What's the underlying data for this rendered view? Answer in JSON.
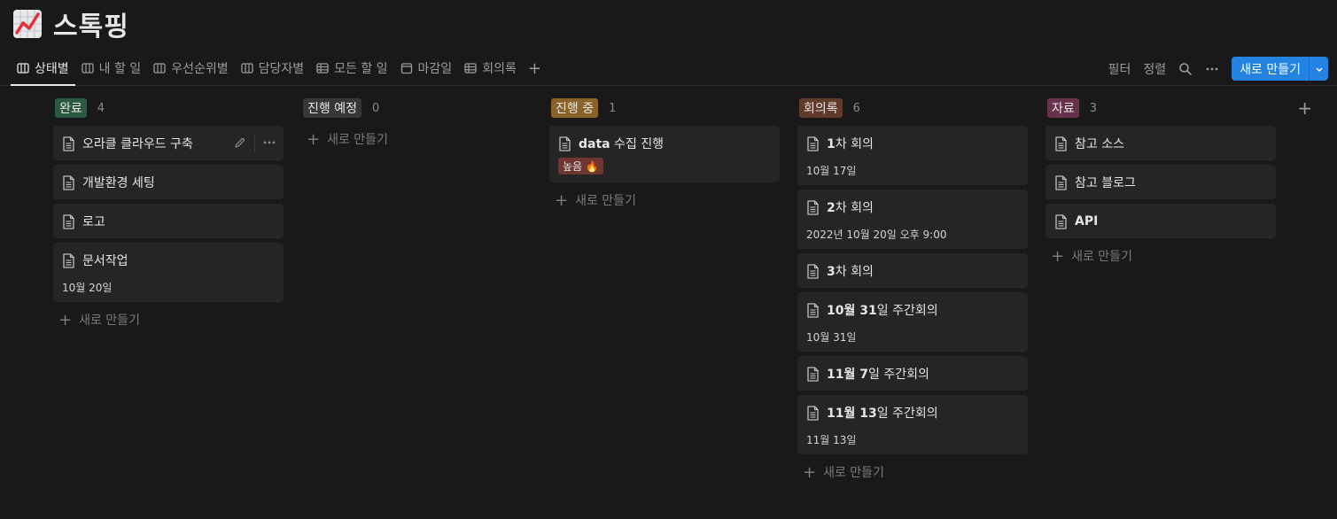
{
  "page": {
    "title": "스톡핑",
    "icon": "chart-increasing-icon"
  },
  "tabs": [
    {
      "label": "상태별",
      "icon": "board-icon",
      "active": true
    },
    {
      "label": "내 할 일",
      "icon": "board-icon"
    },
    {
      "label": "우선순위별",
      "icon": "board-icon"
    },
    {
      "label": "담당자별",
      "icon": "board-icon"
    },
    {
      "label": "모든 할 일",
      "icon": "table-icon"
    },
    {
      "label": "마감일",
      "icon": "calendar-icon"
    },
    {
      "label": "회의록",
      "icon": "table-icon"
    }
  ],
  "toolbar": {
    "filter": "필터",
    "sort": "정렬",
    "new_label": "새로 만들기"
  },
  "new_item_label": "새로 만들기",
  "columns": [
    {
      "name": "완료",
      "count": "4",
      "color": "#2b593f",
      "cards": [
        {
          "title": "오라클 클라우드 구축",
          "hovered": true
        },
        {
          "title": "개발환경 세팅"
        },
        {
          "title": "로고"
        },
        {
          "title": "문서작업",
          "date": "10월 20일"
        }
      ]
    },
    {
      "name": "진행 예정",
      "count": "0",
      "color": "#373737",
      "cards": []
    },
    {
      "name": "진행 중",
      "count": "1",
      "color": "#89632a",
      "cards": [
        {
          "title_bold": "data",
          "title_rest": " 수집 진행",
          "tag": "높음 🔥"
        }
      ]
    },
    {
      "name": "회의록",
      "count": "6",
      "color": "#603b2c",
      "cards": [
        {
          "title_bold": "1",
          "title_rest": "차 회의",
          "date": "10월 17일"
        },
        {
          "title_bold": "2",
          "title_rest": "차 회의",
          "date": "2022년 10월 20일 오후 9:00"
        },
        {
          "title_bold": "3",
          "title_rest": "차 회의"
        },
        {
          "title_bold": "10월 31",
          "title_rest": "일 주간회의",
          "date": "10월 31일"
        },
        {
          "title_bold": "11월 7",
          "title_rest": "일 주간회의"
        },
        {
          "title_bold": "11월 13",
          "title_rest": "일 주간회의",
          "date": "11월 13일"
        }
      ]
    },
    {
      "name": "자료",
      "count": "3",
      "color": "#69314c",
      "cards": [
        {
          "title": "참고 소스"
        },
        {
          "title": "참고 블로그"
        },
        {
          "title_bold": "API",
          "title_rest": ""
        }
      ]
    }
  ]
}
